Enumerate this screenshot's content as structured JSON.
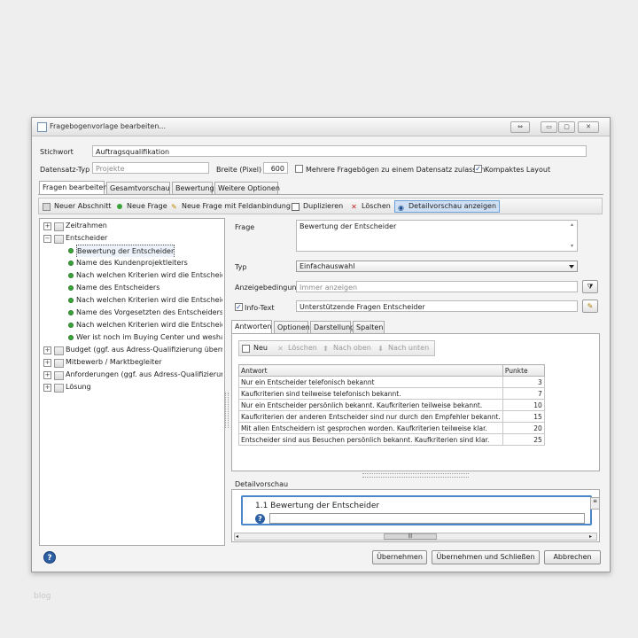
{
  "window": {
    "title": "Fragebogenvorlage bearbeiten...",
    "controls": {
      "restore": "⇔",
      "minimize": "▭",
      "maximize": "▢",
      "close": "✕"
    }
  },
  "form": {
    "stichwort_label": "Stichwort",
    "stichwort_value": "Auftragsqualifikation",
    "datensatz_label": "Datensatz-Typ",
    "datensatz_placeholder": "Projekte",
    "breite_label": "Breite (Pixel)",
    "breite_value": "600",
    "mehrere_label": "Mehrere Fragebögen zu einem Datensatz zulassen",
    "mehrere_checked": false,
    "kompakt_label": "Kompaktes Layout",
    "kompakt_checked": true
  },
  "tabs": [
    "Fragen bearbeiten",
    "Gesamtvorschau",
    "Bewertung",
    "Weitere Optionen"
  ],
  "toolbar": {
    "neuer_abschnitt": "Neuer Abschnitt",
    "neue_frage": "Neue Frage",
    "neue_frage_feld": "Neue Frage mit Feldanbindung",
    "duplizieren": "Duplizieren",
    "loeschen": "Löschen",
    "detailvorschau": "Detailvorschau anzeigen"
  },
  "tree": [
    {
      "label": "Zeitrahmen",
      "level": 0,
      "type": "folder"
    },
    {
      "label": "Entscheider",
      "level": 0,
      "type": "folder",
      "expanded": true
    },
    {
      "label": "Bewertung der Entscheider",
      "level": 1,
      "type": "question",
      "selected": true
    },
    {
      "label": "Name des Kundenprojektleiters",
      "level": 1,
      "type": "question"
    },
    {
      "label": "Nach welchen Kriterien wird die Entscheidung ge",
      "level": 1,
      "type": "question"
    },
    {
      "label": "Name des Entscheiders",
      "level": 1,
      "type": "question"
    },
    {
      "label": "Nach welchen Kriterien wird die Entscheidung ge",
      "level": 1,
      "type": "question"
    },
    {
      "label": "Name des Vorgesetzten des Entscheiders",
      "level": 1,
      "type": "question"
    },
    {
      "label": "Nach welchen Kriterien wird die Entscheidung ge",
      "level": 1,
      "type": "question"
    },
    {
      "label": "Wer ist noch im Buying Center und weshalb?",
      "level": 1,
      "type": "question"
    },
    {
      "label": "Budget (ggf. aus Adress-Qualifizierung übernehme",
      "level": 0,
      "type": "folder"
    },
    {
      "label": "Mitbewerb / Marktbegleiter",
      "level": 0,
      "type": "folder"
    },
    {
      "label": "Anforderungen (ggf. aus Adress-Qualifizierung üb",
      "level": 0,
      "type": "folder"
    },
    {
      "label": "Lösung",
      "level": 0,
      "type": "folder"
    }
  ],
  "detail": {
    "frage_label": "Frage",
    "frage_value": "Bewertung der Entscheider",
    "typ_label": "Typ",
    "typ_value": "Einfachauswahl",
    "anzeige_label": "Anzeigebedingung",
    "anzeige_placeholder": "Immer anzeigen",
    "info_label": "Info-Text",
    "info_checked": true,
    "info_value": "Unterstützende Fragen Entscheider"
  },
  "subtabs": [
    "Antworten",
    "Optionen",
    "Darstellung",
    "Spalten"
  ],
  "answers_toolbar": {
    "neu": "Neu",
    "loeschen": "Löschen",
    "nach_oben": "Nach oben",
    "nach_unten": "Nach unten"
  },
  "answers": {
    "headers": [
      "Antwort",
      "Punkte"
    ],
    "rows": [
      {
        "antwort": "Nur ein Entscheider telefonisch bekannt",
        "punkte": "3"
      },
      {
        "antwort": "Kaufkriterien sind teilweise telefonisch bekannt.",
        "punkte": "7"
      },
      {
        "antwort": "Nur ein Entscheider persönlich bekannt. Kaufkriterien teilweise bekannt.",
        "punkte": "10"
      },
      {
        "antwort": "Kaufkriterien der anderen Entscheider sind nur durch den Empfehler bekannt.",
        "punkte": "15"
      },
      {
        "antwort": "Mit allen Entscheidern ist gesprochen worden. Kaufkriterien teilweise klar.",
        "punkte": "20"
      },
      {
        "antwort": "Entscheider sind aus Besuchen persönlich bekannt. Kaufkriterien sind klar.",
        "punkte": "25"
      }
    ]
  },
  "preview": {
    "label": "Detailvorschau",
    "heading": "1.1 Bewertung der Entscheider"
  },
  "footer": {
    "uebernehmen": "Übernehmen",
    "uebernehmen_schliessen": "Übernehmen und Schließen",
    "abbrechen": "Abbrechen"
  },
  "watermark": "blog"
}
